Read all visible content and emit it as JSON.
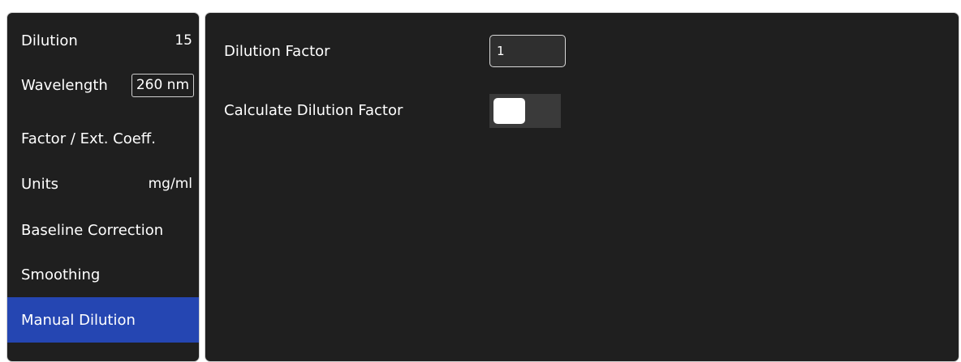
{
  "sidebar": {
    "items": [
      {
        "label": "Dilution",
        "value": "15"
      },
      {
        "label": "Wavelength",
        "value": "260 nm"
      },
      {
        "label": "Factor / Ext. Coeff.",
        "value": ""
      },
      {
        "label": "Units",
        "value": "mg/ml"
      },
      {
        "label": "Baseline Correction",
        "value": ""
      },
      {
        "label": "Smoothing",
        "value": ""
      },
      {
        "label": "Manual Dilution",
        "value": "",
        "active": true
      }
    ]
  },
  "main": {
    "dilution_factor_label": "Dilution Factor",
    "dilution_factor_value": "1",
    "calculate_label": "Calculate Dilution Factor",
    "calculate_enabled": false
  },
  "colors": {
    "panel_bg": "#1f1f1f",
    "active_item": "#2546b2",
    "border": "#cfcfcf",
    "text": "#ffffff"
  }
}
